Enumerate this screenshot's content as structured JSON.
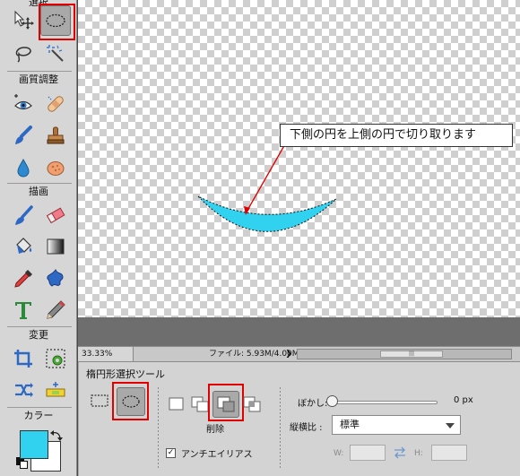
{
  "toolbox": {
    "sections": {
      "select": "選択",
      "enhance": "画質調整",
      "draw": "描画",
      "modify": "変更",
      "color": "カラー"
    },
    "colors": {
      "foreground": "#31d2f0",
      "background": "#ffffff"
    }
  },
  "canvas": {
    "callout_text": "下側の円を上側の円で切り取ります",
    "shape_color": "#31d2f0"
  },
  "statusbar": {
    "zoom": "33.33%",
    "file_label": "ファイル: 5.93M/4.00M",
    "arrow": "❯",
    "scroll_thumb": "|||"
  },
  "options": {
    "title": "楕円形選択ツール",
    "delete_label": "削除",
    "antialias_label": "アンチエイリアス",
    "antialias_checked": true,
    "feather_label": "ぼかし:",
    "feather_value": "0 px",
    "aspect_label": "縦横比 :",
    "aspect_value": "標準",
    "w_label": "W:",
    "h_label": "H:"
  },
  "accent": {
    "highlight_red": "#e00000"
  }
}
